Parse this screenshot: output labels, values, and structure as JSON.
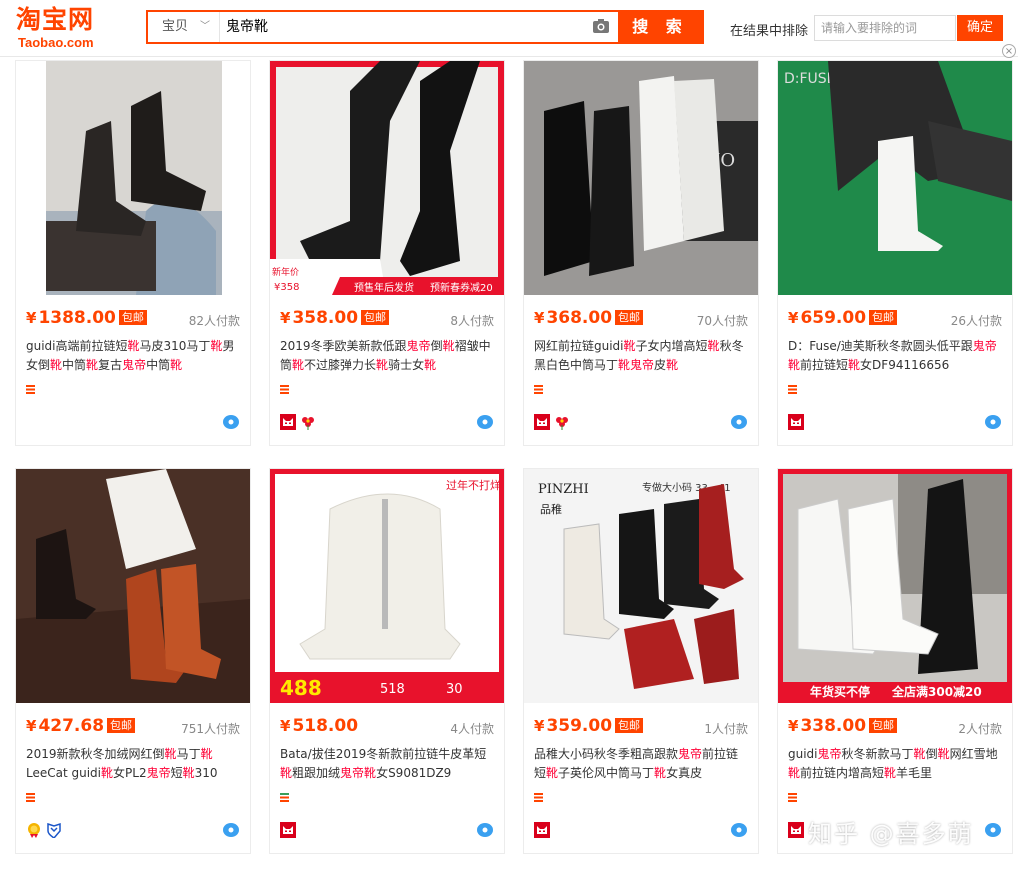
{
  "header": {
    "logo_cn": "淘宝网",
    "logo_en": "Taobao.com",
    "search_scope": "宝贝",
    "search_query": "鬼帝靴",
    "search_button": "搜 索",
    "exclude_label": "在结果中排除",
    "exclude_placeholder": "请输入要排除的词",
    "exclude_confirm": "确定",
    "close": "×"
  },
  "colors": {
    "accent": "#ff4400",
    "highlight": "#ff0036"
  },
  "products": [
    {
      "yen": "¥",
      "price": "1388.00",
      "free_shipping": "包邮",
      "sales": "82人付款",
      "title_parts": [
        {
          "t": "guidi高端前拉链短"
        },
        {
          "t": "靴",
          "hl": true
        },
        {
          "t": "马皮310马丁"
        },
        {
          "t": "靴",
          "hl": true
        },
        {
          "t": "男女倒"
        },
        {
          "t": "靴",
          "hl": true
        },
        {
          "t": "中筒"
        },
        {
          "t": "靴",
          "hl": true
        },
        {
          "t": "复古"
        },
        {
          "t": "鬼帝",
          "hl": true
        },
        {
          "t": "中筒"
        },
        {
          "t": "靴",
          "hl": true
        }
      ],
      "badges": [],
      "image_overlay": []
    },
    {
      "yen": "¥",
      "price": "358.00",
      "free_shipping": "包邮",
      "sales": "8人付款",
      "title_parts": [
        {
          "t": "2019冬季欧美新款低跟"
        },
        {
          "t": "鬼帝",
          "hl": true
        },
        {
          "t": "倒"
        },
        {
          "t": "靴",
          "hl": true
        },
        {
          "t": "褶皱中筒"
        },
        {
          "t": "靴",
          "hl": true
        },
        {
          "t": "不过膝弹力长"
        },
        {
          "t": "靴",
          "hl": true
        },
        {
          "t": "骑士女"
        },
        {
          "t": "靴",
          "hl": true
        }
      ],
      "badges": [
        "tmall-icon",
        "flower-icon"
      ],
      "image_overlay": [
        "新年价",
        "¥358",
        "预售年后发货",
        "预新春券减20"
      ]
    },
    {
      "yen": "¥",
      "price": "368.00",
      "free_shipping": "包邮",
      "sales": "70人付款",
      "title_parts": [
        {
          "t": "网红前拉链guidi"
        },
        {
          "t": "靴",
          "hl": true
        },
        {
          "t": "子女内增高短"
        },
        {
          "t": "靴",
          "hl": true
        },
        {
          "t": "秋冬黑白色中筒马丁"
        },
        {
          "t": "靴",
          "hl": true
        },
        {
          "t": "鬼帝",
          "hl": true
        },
        {
          "t": "皮"
        },
        {
          "t": "靴",
          "hl": true
        }
      ],
      "badges": [
        "tmall-icon",
        "flower-icon"
      ],
      "image_overlay": [
        "MO"
      ]
    },
    {
      "yen": "¥",
      "price": "659.00",
      "free_shipping": "包邮",
      "sales": "26人付款",
      "title_parts": [
        {
          "t": "D：Fuse/迪芙斯秋冬款圆头低平跟"
        },
        {
          "t": "鬼帝",
          "hl": true
        },
        {
          "t": "靴",
          "hl": true
        },
        {
          "t": "前拉链短"
        },
        {
          "t": "靴",
          "hl": true
        },
        {
          "t": "女DF94116656"
        }
      ],
      "badges": [
        "tmall-icon"
      ],
      "image_overlay": [
        "D:FUSE"
      ]
    },
    {
      "yen": "¥",
      "price": "427.68",
      "free_shipping": "包邮",
      "sales": "751人付款",
      "title_parts": [
        {
          "t": "2019新款秋冬加绒网红倒"
        },
        {
          "t": "靴",
          "hl": true
        },
        {
          "t": "马丁"
        },
        {
          "t": "靴",
          "hl": true
        },
        {
          "t": "LeeCat guidi"
        },
        {
          "t": "靴",
          "hl": true
        },
        {
          "t": "女PL2"
        },
        {
          "t": "鬼帝",
          "hl": true
        },
        {
          "t": "短"
        },
        {
          "t": "靴",
          "hl": true
        },
        {
          "t": "310"
        }
      ],
      "badges": [
        "gold-medal-icon",
        "shield-icon"
      ],
      "image_overlay": []
    },
    {
      "yen": "¥",
      "price": "518.00",
      "free_shipping": "",
      "sales": "4人付款",
      "title_parts": [
        {
          "t": "Bata/拔佳2019冬新款前拉链牛皮革短"
        },
        {
          "t": "靴",
          "hl": true
        },
        {
          "t": "粗跟加绒"
        },
        {
          "t": "鬼帝",
          "hl": true
        },
        {
          "t": "靴",
          "hl": true
        },
        {
          "t": "女S9081DZ9"
        }
      ],
      "badges": [
        "tmall-icon"
      ],
      "image_overlay": [
        "488",
        "518",
        "30",
        "过年不打烊"
      ]
    },
    {
      "yen": "¥",
      "price": "359.00",
      "free_shipping": "包邮",
      "sales": "1人付款",
      "title_parts": [
        {
          "t": "品稚大小码秋冬季粗高跟款"
        },
        {
          "t": "鬼帝",
          "hl": true
        },
        {
          "t": "前拉链短"
        },
        {
          "t": "靴",
          "hl": true
        },
        {
          "t": "子英伦风中筒马丁"
        },
        {
          "t": "靴",
          "hl": true
        },
        {
          "t": "女真皮"
        }
      ],
      "badges": [
        "tmall-icon"
      ],
      "image_overlay": [
        "PINZHI",
        "品稚",
        "专做大小码 33—41"
      ]
    },
    {
      "yen": "¥",
      "price": "338.00",
      "free_shipping": "包邮",
      "sales": "2人付款",
      "title_parts": [
        {
          "t": "guidi"
        },
        {
          "t": "鬼帝",
          "hl": true
        },
        {
          "t": "秋冬新款马丁"
        },
        {
          "t": "靴",
          "hl": true
        },
        {
          "t": "倒"
        },
        {
          "t": "靴",
          "hl": true
        },
        {
          "t": "网红雪地"
        },
        {
          "t": "靴",
          "hl": true
        },
        {
          "t": "前拉链内增高短"
        },
        {
          "t": "靴",
          "hl": true
        },
        {
          "t": "羊毛里"
        }
      ],
      "badges": [
        "tmall-icon"
      ],
      "image_overlay": [
        "年货买不停",
        "全店满300减20"
      ]
    }
  ],
  "watermark": "知乎 @喜多萌"
}
